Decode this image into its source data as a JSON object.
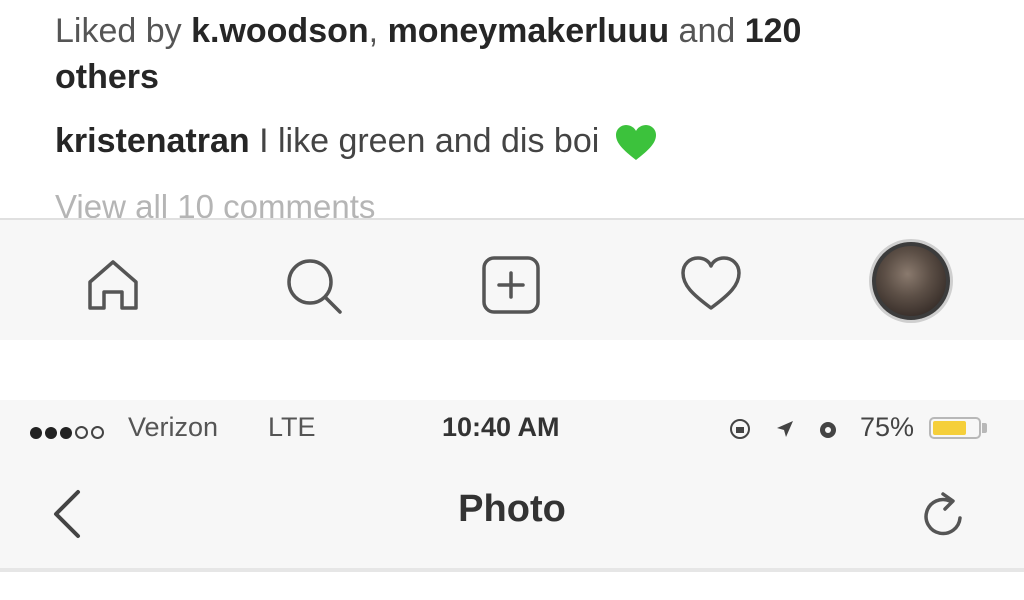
{
  "post": {
    "likes_prefix": "Liked by ",
    "liker_1": "k.woodson",
    "liker_sep": ", ",
    "liker_2": "moneymakerluuu",
    "likes_and": " and ",
    "likes_count": "120",
    "likes_suffix": "others",
    "caption_user": "kristenatran",
    "caption_text": " I like green and dis boi ",
    "caption_emoji_icon": "green-heart-emoji",
    "view_comments": "View all 10 comments"
  },
  "tabbar": {
    "items": [
      {
        "name": "home",
        "icon": "home-icon"
      },
      {
        "name": "search",
        "icon": "search-icon"
      },
      {
        "name": "new-post",
        "icon": "plus-square-icon"
      },
      {
        "name": "activity",
        "icon": "heart-icon"
      },
      {
        "name": "profile",
        "icon": "avatar"
      }
    ]
  },
  "statusbar": {
    "carrier": "Verizon",
    "network": "LTE",
    "time": "10:40 AM",
    "battery_pct": "75%",
    "battery_level": 0.75,
    "battery_color": "#f5cf3b"
  },
  "navbar": {
    "title": "Photo",
    "back_icon": "chevron-left-icon",
    "refresh_icon": "refresh-icon"
  }
}
